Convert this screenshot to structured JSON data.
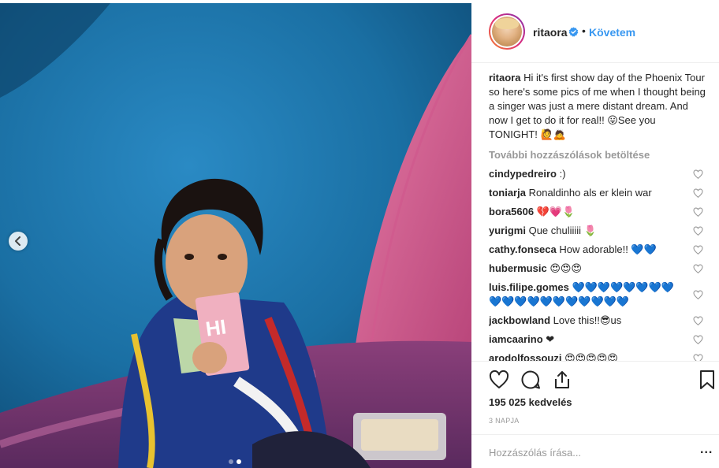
{
  "post": {
    "username": "ritaora",
    "follow_label": "Követem",
    "separator": "•",
    "caption_text": "Hi it's first show day of the Phoenix Tour so here's some pics of me when I thought being a singer was just a mere distant dream. And now I get to do it for real!! 😛See you TONIGHT! 🙋🙇",
    "load_more": "További hozzászólások betöltése",
    "comments": [
      {
        "user": "cindypedreiro",
        "text": ":)"
      },
      {
        "user": "toniarja",
        "text": "Ronaldinho als er klein war"
      },
      {
        "user": "bora5606",
        "text": "💔💗🌷"
      },
      {
        "user": "yurigmi",
        "text": "Que chuliiiii 🌷"
      },
      {
        "user": "cathy.fonseca",
        "text": "How adorable!! 💙💙"
      },
      {
        "user": "hubermusic",
        "text": "😍😍😍"
      },
      {
        "user": "luis.filipe.gomes",
        "text": "💙💙💙💙💙💙💙💙💙💙💙💙💙💙💙💙💙💙💙"
      },
      {
        "user": "jackbowland",
        "text": "Love this!!😎us"
      },
      {
        "user": "iamcaarino",
        "text": "❤"
      },
      {
        "user": "arodolfossouzi",
        "text": "😍😍😍😍😍"
      }
    ],
    "likes": "195 025 kedvelés",
    "time": "3 NAPJA",
    "comment_placeholder": "Hozzászólás írása...",
    "more_label": "..."
  },
  "colors": {
    "accent": "#3897f0",
    "text": "#262626",
    "muted": "#999999"
  },
  "icons": {
    "prev": "chevron-left-icon",
    "verified": "verified-badge-icon",
    "like": "heart-icon",
    "comment": "comment-icon",
    "share": "share-icon",
    "save": "bookmark-icon",
    "comment_like": "small-heart-icon"
  },
  "carousel": {
    "slides": 2,
    "active": 2
  }
}
